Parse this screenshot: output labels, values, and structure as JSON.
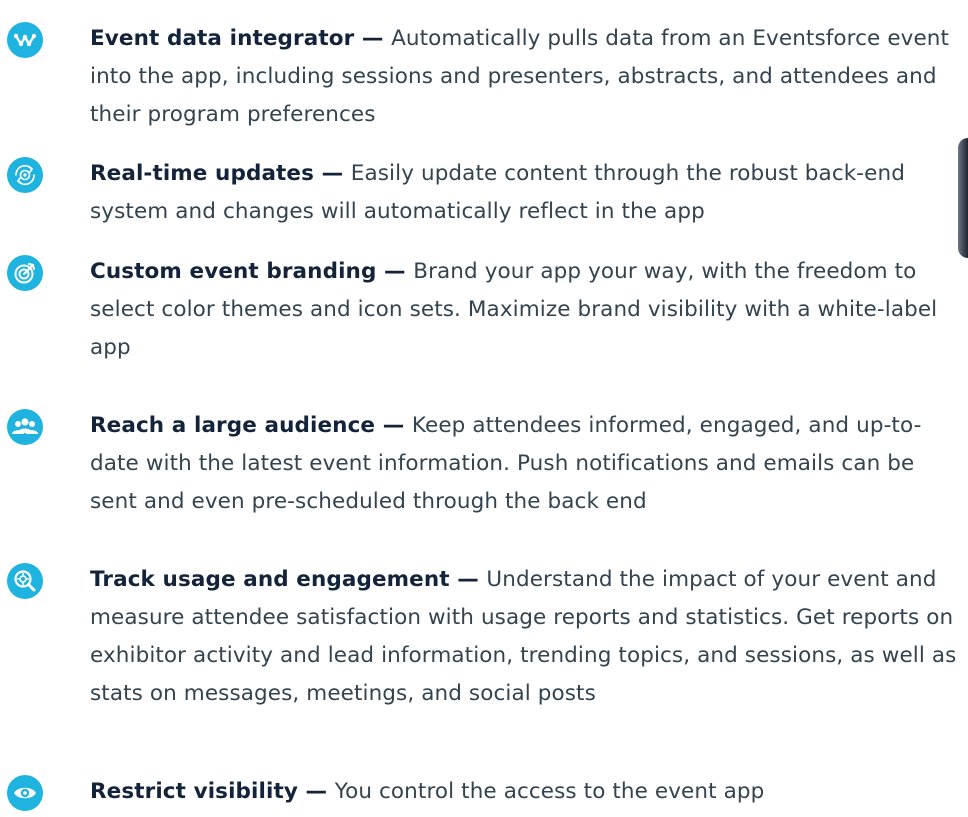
{
  "features": [
    {
      "icon": "workflow-icon",
      "title": "Event data integrator",
      "separator": " — ",
      "description": "Automatically pulls data from an Eventsforce event into the app, including sessions and presenters, abstracts, and attendees and their program preferences"
    },
    {
      "icon": "gear-refresh-icon",
      "title": "Real-time updates",
      "separator": " — ",
      "description": "Easily update content through the robust back-end system and changes will automatically reflect in the app"
    },
    {
      "icon": "target-icon",
      "title": "Custom event branding",
      "separator": " — ",
      "description": "Brand your app your way, with the freedom to select color themes and icon sets. Maximize brand visibility with a white-label app"
    },
    {
      "icon": "group-icon",
      "title": "Reach a large audience",
      "separator": " — ",
      "description": "Keep attendees informed, engaged, and up-to-date with the latest event information. Push notifications and emails can be sent and even pre-scheduled through the back end"
    },
    {
      "icon": "magnifier-gear-icon",
      "title": "Track usage and engagement",
      "separator": " — ",
      "description": "Understand the impact of your event and measure attendee satisfaction with usage reports and statistics. Get reports on exhibitor activity and lead information, trending topics, and sessions, as well as stats on messages, meetings, and social posts"
    },
    {
      "icon": "eye-icon",
      "title": "Restrict visibility",
      "separator": " — ",
      "description": "You control the access to the event app"
    }
  ],
  "colors": {
    "accent": "#1fb3e0",
    "title": "#13233a",
    "body": "#33434f"
  }
}
